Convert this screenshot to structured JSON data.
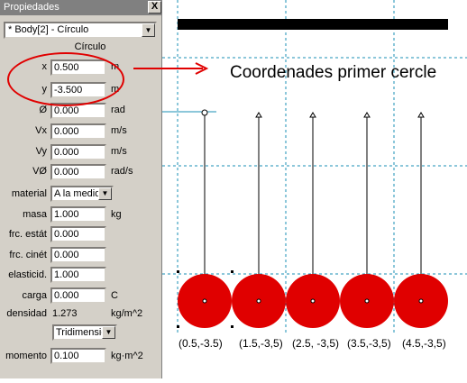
{
  "panel": {
    "title": "Propiedades",
    "close_label": "X",
    "object_select": "* Body[2] - Círculo",
    "heading": "Círculo",
    "rows": {
      "x": {
        "label": "x",
        "value": "0.500",
        "unit": "m"
      },
      "y": {
        "label": "y",
        "value": "-3.500",
        "unit": "m"
      },
      "angle": {
        "label": "Ø",
        "value": "0.000",
        "unit": "rad"
      },
      "vx": {
        "label": "Vx",
        "value": "0.000",
        "unit": "m/s"
      },
      "vy": {
        "label": "Vy",
        "value": "0.000",
        "unit": "m/s"
      },
      "vo": {
        "label": "VØ",
        "value": "0.000",
        "unit": "rad/s"
      },
      "material": {
        "label": "material",
        "value": "A la medida"
      },
      "masa": {
        "label": "masa",
        "value": "1.000",
        "unit": "kg"
      },
      "frc_estat": {
        "label": "frc. estát",
        "value": "0.000"
      },
      "frc_cinet": {
        "label": "frc. cinét",
        "value": "0.000"
      },
      "elasticid": {
        "label": "elasticid.",
        "value": "1.000"
      },
      "carga": {
        "label": "carga",
        "value": "0.000",
        "unit": "C"
      },
      "densidad": {
        "label": "densidad",
        "value": "1.273",
        "unit": "kg/m^2"
      },
      "dimension": {
        "value": "Tridimensional"
      },
      "momento": {
        "label": "momento",
        "value": "0.100",
        "unit": "kg·m^2"
      }
    }
  },
  "annotation": {
    "text": "Coordenades primer cercle",
    "color": "#e00000"
  },
  "canvas": {
    "ball_color": "#e00000",
    "grid_color": "#1a8fb5",
    "coordinates": [
      "(0.5,-3.5)",
      "(1.5,-3,5)",
      "(2.5, -3,5)",
      "(3.5,-3,5)",
      "(4.5,-3,5)"
    ]
  }
}
